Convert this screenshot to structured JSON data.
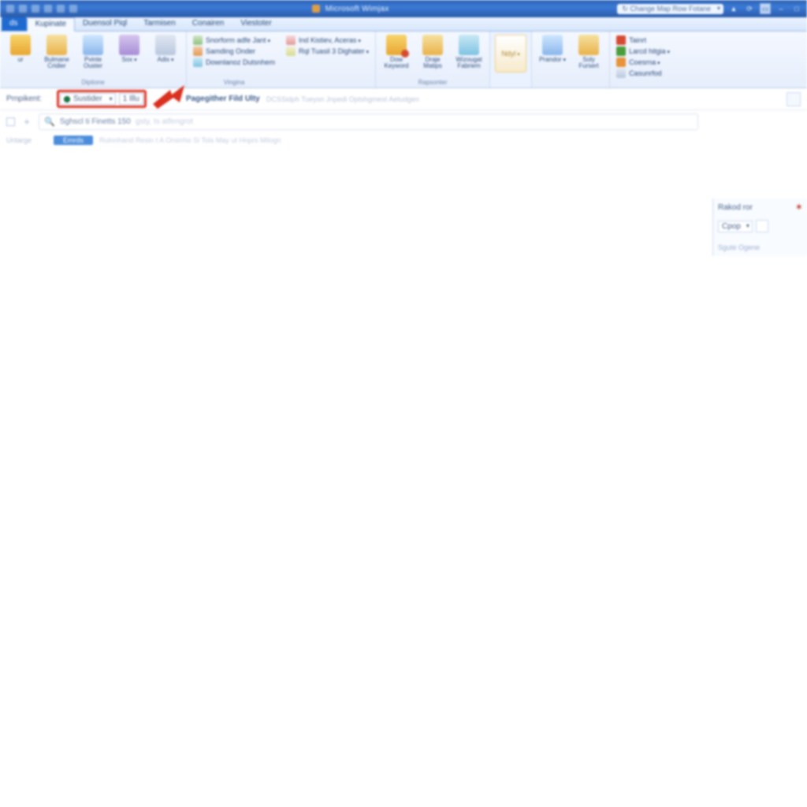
{
  "titlebar": {
    "app_title": "Microsoft Wimjax",
    "search_placeholder": "Change Map Row Fotane"
  },
  "tabs": {
    "file": "ds",
    "items": [
      "Kupinate",
      "Duensol Piql",
      "Tarmisen",
      "Conairen",
      "Viestoter"
    ],
    "active_index": 0
  },
  "ribbon": {
    "group1": {
      "label": "Diptione",
      "items": [
        {
          "label": "ur"
        },
        {
          "label": "Bulmane Cridier"
        },
        {
          "label": "Pvinte Ouster"
        },
        {
          "label": "Sox"
        },
        {
          "label": "Adis"
        }
      ]
    },
    "group2": {
      "label": "Vingina",
      "mini": [
        "Snorform adfe Jant",
        "Samding Onder",
        "Downlanoz Dutsnhem"
      ],
      "mini2": [
        "Ind Kistiev, Aceras",
        "Rql Tuasil 3 Dighater"
      ]
    },
    "group3": {
      "label": "Rapsonter",
      "items": [
        {
          "label": "Dow Keyword"
        },
        {
          "label": "Draje Matips"
        },
        {
          "label": "Wizougat Fabriem"
        }
      ]
    },
    "group4": {
      "items": [
        {
          "label": "Ndyl"
        }
      ]
    },
    "group5": {
      "items": [
        {
          "label": "Prandor"
        },
        {
          "label": "Soly Fursert"
        }
      ]
    },
    "group6": {
      "mini": [
        "Tainrt",
        "Larcd hitgia",
        "Coesrna",
        "Casunrfod"
      ]
    }
  },
  "recipients": {
    "label": "Prnpikent:",
    "combo_value": "Sustider",
    "combo_count": "1 Illu",
    "after_label": "Pagegither Fild Ulty",
    "after_hint": "DCSSidph Tueysn Jnpedi Optshgmest Aetudgen"
  },
  "rightpane": {
    "header": "Rakod ror",
    "combo": "Cpop",
    "line": "Sgute Ogene"
  },
  "search": {
    "text": "Sghscl ti Finetts 150",
    "hint": "gsty, ts atfengrot"
  },
  "listrow": {
    "left": "Untarge",
    "chip": "Emrds",
    "rest": "Rulnnhand Resin t A Onsrrho Si Tols May ut Hnprs Milogn"
  }
}
